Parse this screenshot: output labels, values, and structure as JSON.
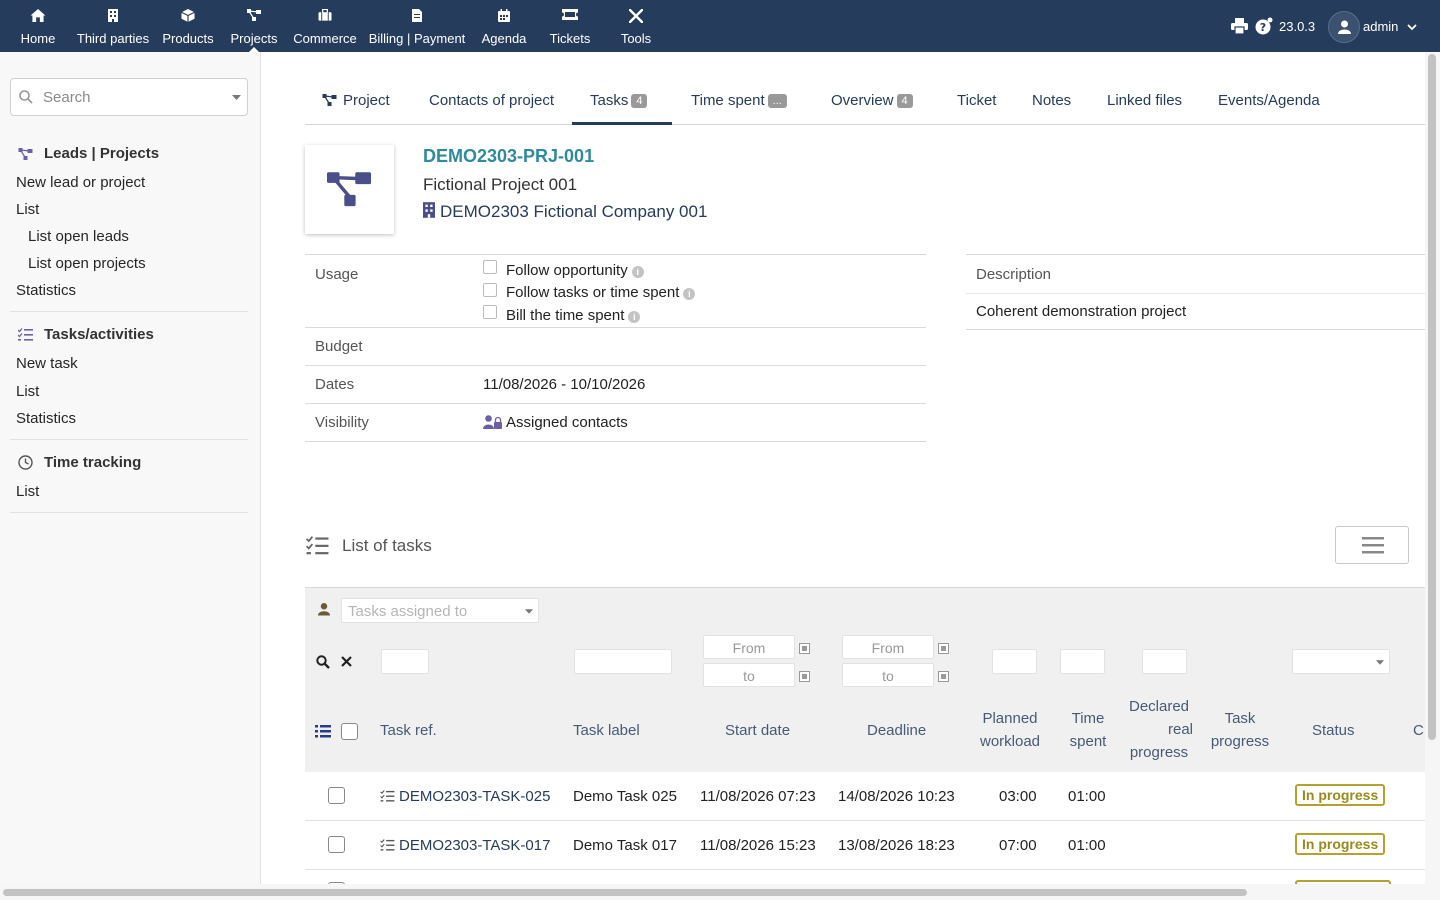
{
  "nav": {
    "items": [
      {
        "label": "Home",
        "icon": "home-icon"
      },
      {
        "label": "Third parties",
        "icon": "building-icon"
      },
      {
        "label": "Products",
        "icon": "cube-icon"
      },
      {
        "label": "Projects",
        "icon": "project-tree-icon"
      },
      {
        "label": "Commerce",
        "icon": "suitcase-icon"
      },
      {
        "label": "Billing | Payment",
        "icon": "invoice-icon"
      },
      {
        "label": "Agenda",
        "icon": "calendar-icon"
      },
      {
        "label": "Tickets",
        "icon": "ticket-icon"
      },
      {
        "label": "Tools",
        "icon": "tools-icon"
      }
    ],
    "active": "Projects",
    "version": "23.0.3",
    "user": "admin"
  },
  "sidebar": {
    "search_placeholder": "Search",
    "sections": [
      {
        "title": "Leads | Projects",
        "icon": "project-tree-icon",
        "links": [
          "New lead or project",
          "List",
          "List open leads",
          "List open projects",
          "Statistics"
        ]
      },
      {
        "title": "Tasks/activities",
        "icon": "tasks-icon",
        "links": [
          "New task",
          "List",
          "Statistics"
        ]
      },
      {
        "title": "Time tracking",
        "icon": "clock-icon",
        "links": [
          "List"
        ]
      }
    ]
  },
  "tabs": [
    {
      "label": "Project",
      "badge": ""
    },
    {
      "label": "Contacts of project",
      "badge": ""
    },
    {
      "label": "Tasks",
      "badge": "4"
    },
    {
      "label": "Time spent",
      "badge": "..."
    },
    {
      "label": "Overview",
      "badge": "4"
    },
    {
      "label": "Ticket",
      "badge": ""
    },
    {
      "label": "Notes",
      "badge": ""
    },
    {
      "label": "Linked files",
      "badge": ""
    },
    {
      "label": "Events/Agenda",
      "badge": ""
    }
  ],
  "project": {
    "ref": "DEMO2303-PRJ-001",
    "name": "Fictional Project 001",
    "company": "DEMO2303 Fictional Company 001"
  },
  "fields": {
    "usage_label": "Usage",
    "usage_options": [
      "Follow opportunity",
      "Follow tasks or time spent",
      "Bill the time spent"
    ],
    "budget_label": "Budget",
    "dates_label": "Dates",
    "dates_value": "11/08/2026 - 10/10/2026",
    "visibility_label": "Visibility",
    "visibility_value": "Assigned contacts",
    "description_label": "Description",
    "description_value": "Coherent demonstration project"
  },
  "tasks": {
    "title": "List of tasks",
    "assigned_placeholder": "Tasks assigned to",
    "filter_from": "From",
    "filter_to": "to",
    "columns": {
      "ref": "Task ref.",
      "label": "Task label",
      "start": "Start date",
      "deadline": "Deadline",
      "planned": [
        "Planned",
        "workload"
      ],
      "spent": [
        "Time",
        "spent"
      ],
      "declared": [
        "Declared",
        "real",
        "progress"
      ],
      "progress": [
        "Task",
        "progress"
      ],
      "status": "Status",
      "extra": "C"
    },
    "rows": [
      {
        "ref": "DEMO2303-TASK-025",
        "label": "Demo Task 025",
        "start": "11/08/2026 07:23",
        "deadline": "14/08/2026 10:23",
        "planned": "03:00",
        "spent": "01:00",
        "status": "In progress"
      },
      {
        "ref": "DEMO2303-TASK-017",
        "label": "Demo Task 017",
        "start": "11/08/2026 15:23",
        "deadline": "13/08/2026 18:23",
        "planned": "07:00",
        "spent": "01:00",
        "status": "In progress"
      }
    ]
  }
}
